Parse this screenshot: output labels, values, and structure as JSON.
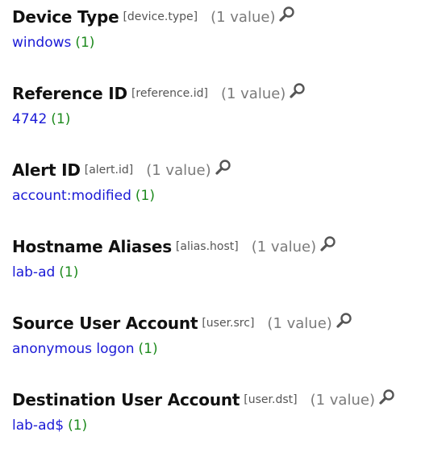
{
  "fields": [
    {
      "name": "Device Type",
      "key": "[device.type]",
      "count": "(1 value)",
      "value": "windows",
      "value_count": "(1)"
    },
    {
      "name": "Reference ID",
      "key": "[reference.id]",
      "count": "(1 value)",
      "value": "4742",
      "value_count": "(1)"
    },
    {
      "name": "Alert ID",
      "key": "[alert.id]",
      "count": "(1 value)",
      "value": "account:modified",
      "value_count": "(1)"
    },
    {
      "name": "Hostname Aliases",
      "key": "[alias.host]",
      "count": "(1 value)",
      "value": "lab-ad",
      "value_count": "(1)"
    },
    {
      "name": "Source User Account",
      "key": "[user.src]",
      "count": "(1 value)",
      "value": "anonymous logon",
      "value_count": "(1)"
    },
    {
      "name": "Destination User Account",
      "key": "[user.dst]",
      "count": "(1 value)",
      "value": "lab-ad$",
      "value_count": "(1)"
    }
  ],
  "icons": {
    "search": "search-icon"
  },
  "colors": {
    "field_name": "#111111",
    "field_key": "#555555",
    "value_count_label": "#7a7a7a",
    "value_link": "#1a1ad6",
    "value_occurrences": "#1d8a1d",
    "icon": "#555555"
  }
}
